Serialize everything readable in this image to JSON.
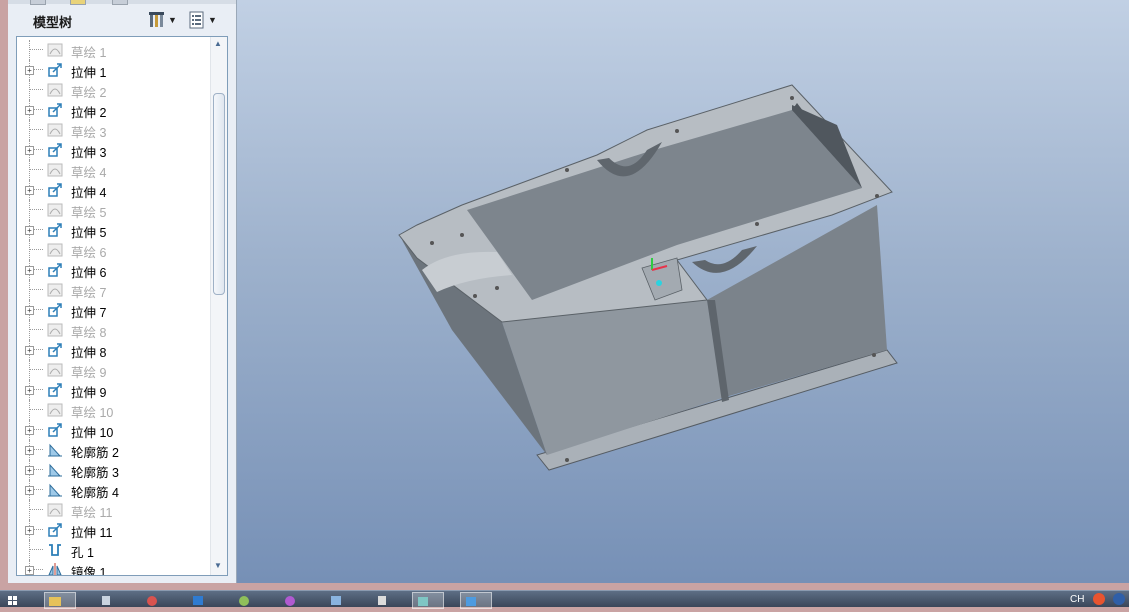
{
  "panel": {
    "title": "模型树"
  },
  "tree": [
    {
      "label": "草绘 1",
      "type": "sketch",
      "dim": true,
      "expandable": false
    },
    {
      "label": "拉伸 1",
      "type": "extrude",
      "dim": false,
      "expandable": true
    },
    {
      "label": "草绘 2",
      "type": "sketch",
      "dim": true,
      "expandable": false
    },
    {
      "label": "拉伸 2",
      "type": "extrude",
      "dim": false,
      "expandable": true
    },
    {
      "label": "草绘 3",
      "type": "sketch",
      "dim": true,
      "expandable": false
    },
    {
      "label": "拉伸 3",
      "type": "extrude",
      "dim": false,
      "expandable": true
    },
    {
      "label": "草绘 4",
      "type": "sketch",
      "dim": true,
      "expandable": false
    },
    {
      "label": "拉伸 4",
      "type": "extrude",
      "dim": false,
      "expandable": true
    },
    {
      "label": "草绘 5",
      "type": "sketch",
      "dim": true,
      "expandable": false
    },
    {
      "label": "拉伸 5",
      "type": "extrude",
      "dim": false,
      "expandable": true
    },
    {
      "label": "草绘 6",
      "type": "sketch",
      "dim": true,
      "expandable": false
    },
    {
      "label": "拉伸 6",
      "type": "extrude",
      "dim": false,
      "expandable": true
    },
    {
      "label": "草绘 7",
      "type": "sketch",
      "dim": true,
      "expandable": false
    },
    {
      "label": "拉伸 7",
      "type": "extrude",
      "dim": false,
      "expandable": true
    },
    {
      "label": "草绘 8",
      "type": "sketch",
      "dim": true,
      "expandable": false
    },
    {
      "label": "拉伸 8",
      "type": "extrude",
      "dim": false,
      "expandable": true
    },
    {
      "label": "草绘 9",
      "type": "sketch",
      "dim": true,
      "expandable": false
    },
    {
      "label": "拉伸 9",
      "type": "extrude",
      "dim": false,
      "expandable": true
    },
    {
      "label": "草绘 10",
      "type": "sketch",
      "dim": true,
      "expandable": false
    },
    {
      "label": "拉伸 10",
      "type": "extrude",
      "dim": false,
      "expandable": true
    },
    {
      "label": "轮廓筋 2",
      "type": "rib",
      "dim": false,
      "expandable": true
    },
    {
      "label": "轮廓筋 3",
      "type": "rib",
      "dim": false,
      "expandable": true
    },
    {
      "label": "轮廓筋 4",
      "type": "rib",
      "dim": false,
      "expandable": true
    },
    {
      "label": "草绘 11",
      "type": "sketch",
      "dim": true,
      "expandable": false
    },
    {
      "label": "拉伸 11",
      "type": "extrude",
      "dim": false,
      "expandable": true
    },
    {
      "label": "孔 1",
      "type": "hole",
      "dim": false,
      "expandable": false
    },
    {
      "label": "镜像 1",
      "type": "mirror",
      "dim": false,
      "expandable": true
    }
  ],
  "tray": {
    "lang": "CH"
  },
  "colors": {
    "viewport_top": "#c1d0e4",
    "viewport_bottom": "#7690b6",
    "model_gray": "#8c949c",
    "tree_border": "#7f9db9"
  },
  "icons": {
    "tools": "tools-icon",
    "show": "show-list-icon",
    "sketch": "sketch-icon",
    "extrude": "extrude-icon",
    "rib": "rib-icon",
    "hole": "hole-icon",
    "mirror": "mirror-icon"
  }
}
